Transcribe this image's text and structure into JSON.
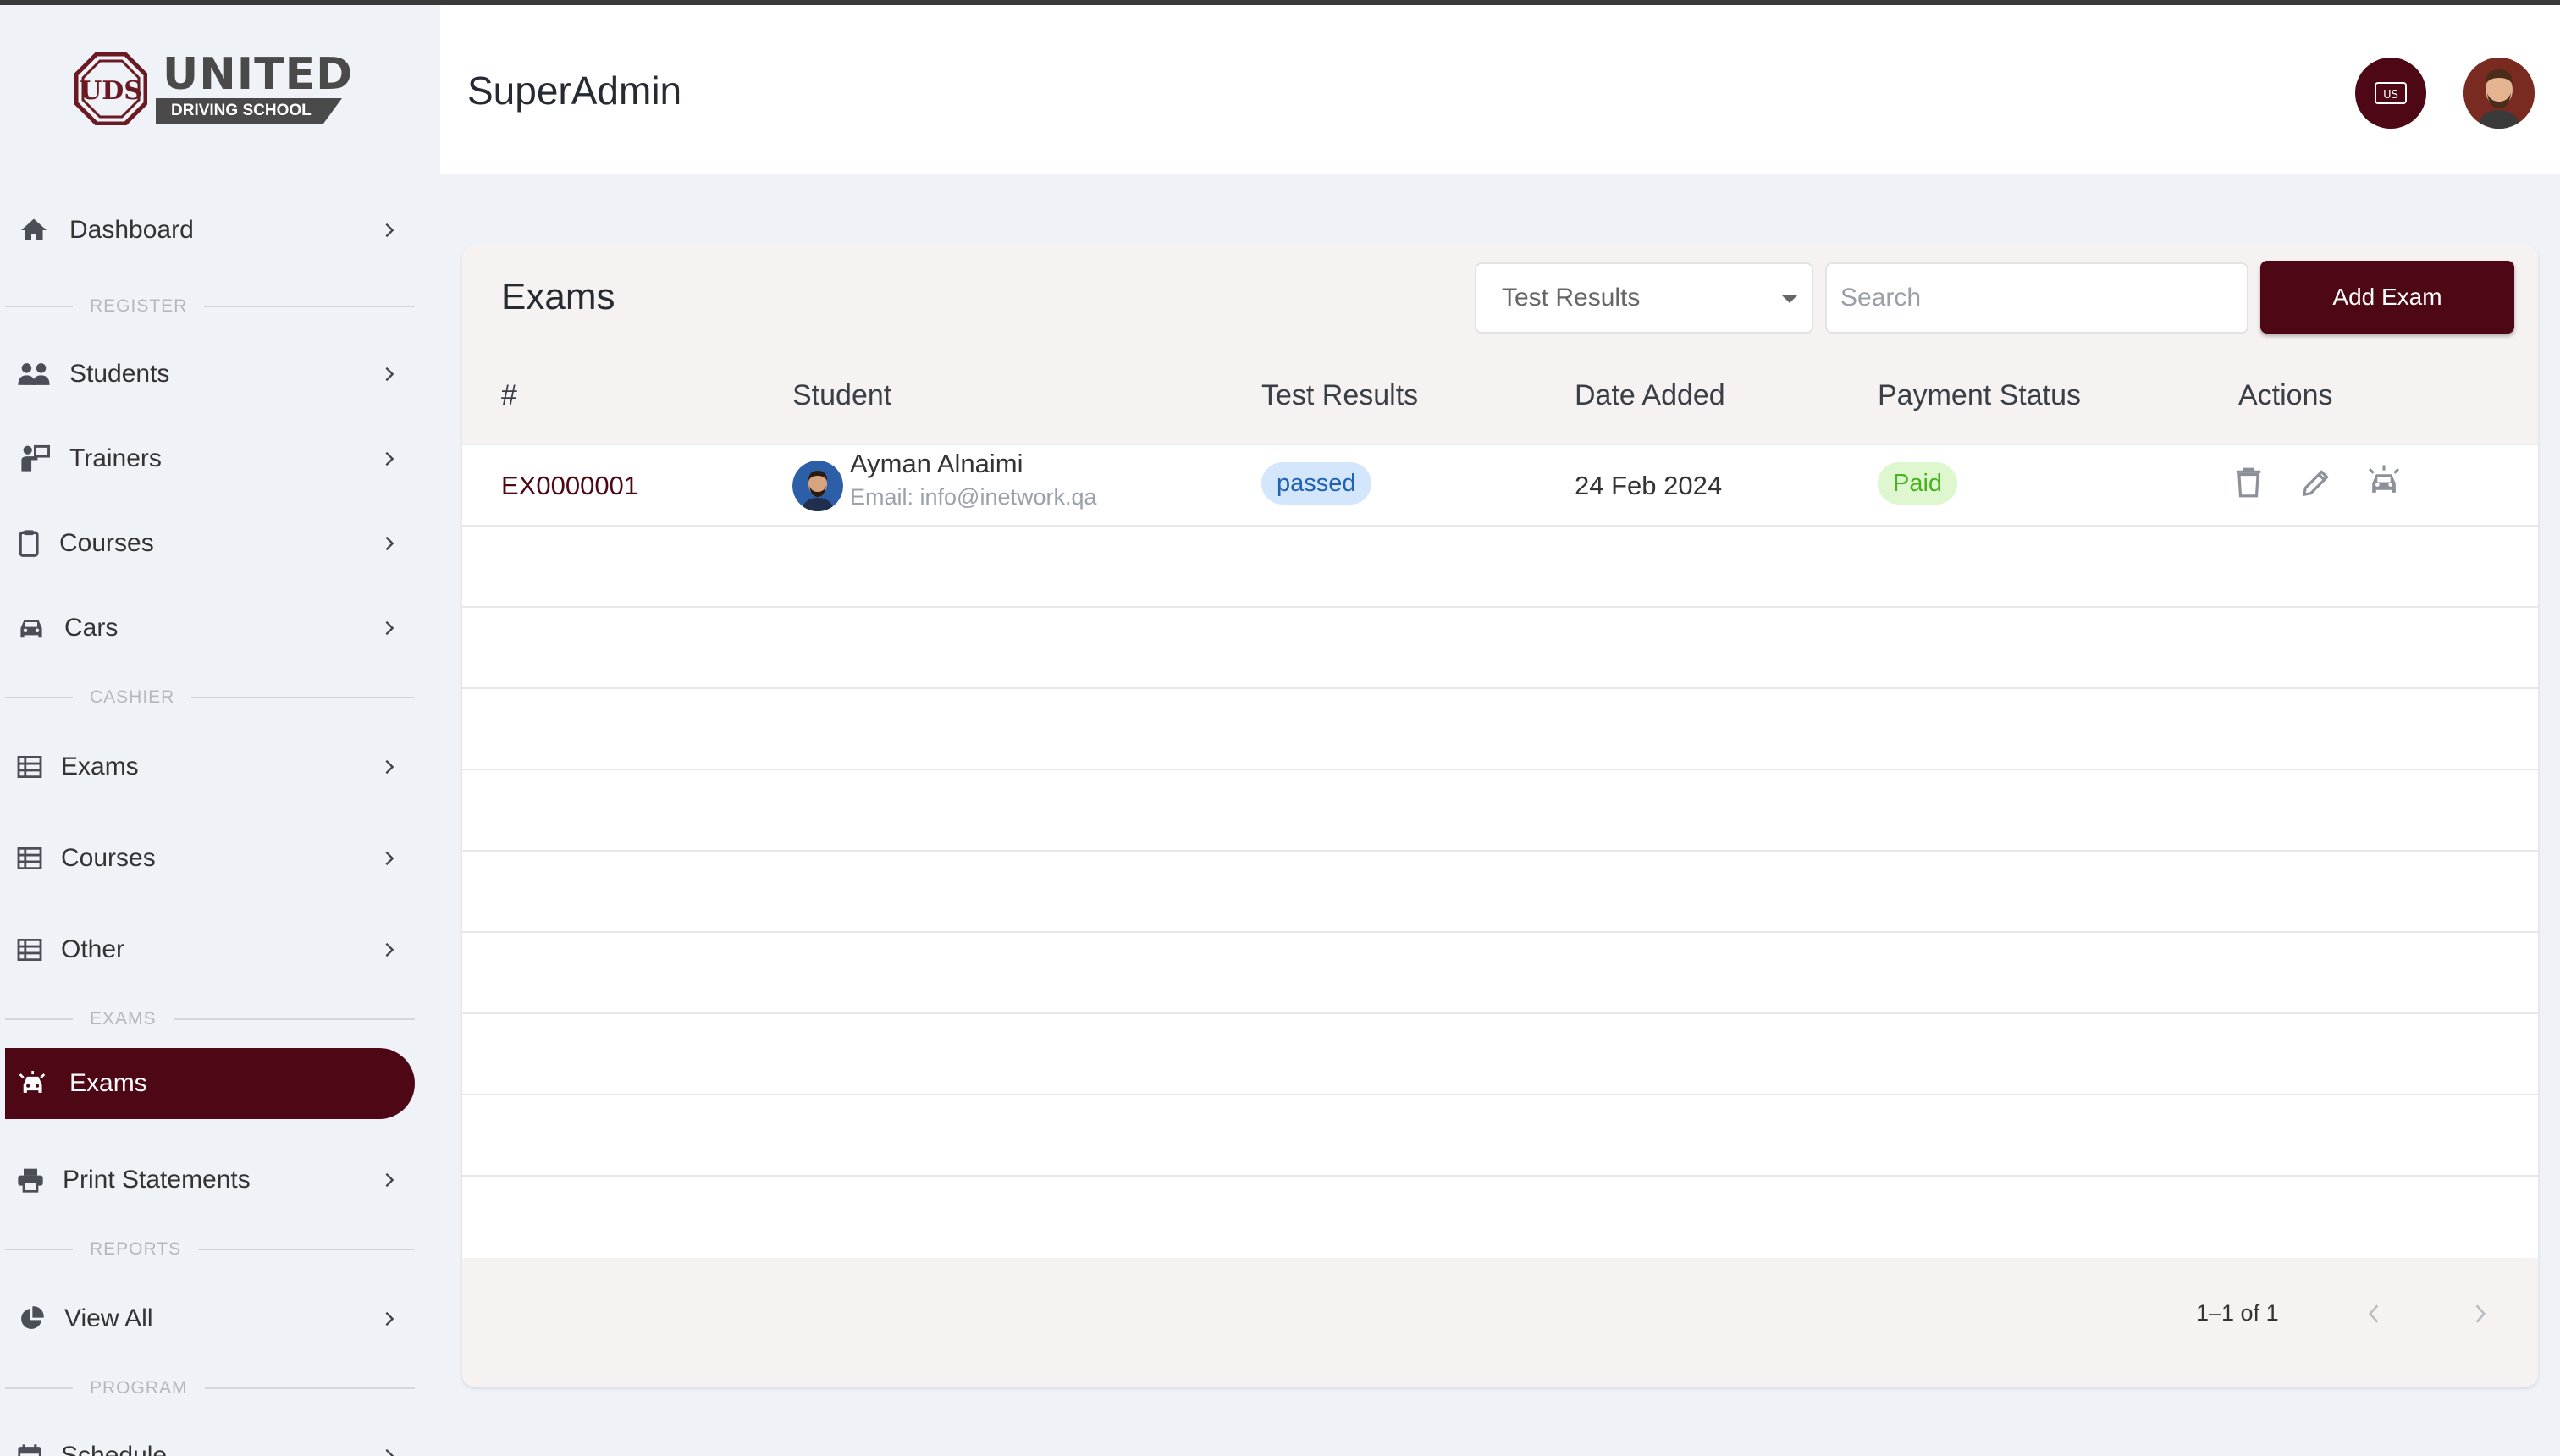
{
  "brand": {
    "name": "UNITED",
    "tagline": "DRIVING SCHOOL",
    "colors": {
      "primary": "#4e0714",
      "sidebar_bg": "#eff3f8",
      "card_header_bg": "#f6f2f1"
    }
  },
  "header": {
    "title": "SuperAdmin",
    "language_icon": "us-flag-icon",
    "avatar_icon": "user-avatar"
  },
  "sidebar": {
    "items": [
      {
        "label": "Dashboard",
        "icon": "home-icon"
      },
      {
        "section": "REGISTER"
      },
      {
        "label": "Students",
        "icon": "users-icon"
      },
      {
        "label": "Trainers",
        "icon": "trainer-icon"
      },
      {
        "label": "Courses",
        "icon": "clipboard-icon"
      },
      {
        "label": "Cars",
        "icon": "car-icon"
      },
      {
        "section": "CASHIER"
      },
      {
        "label": "Exams",
        "icon": "table-icon"
      },
      {
        "label": "Courses",
        "icon": "table-icon"
      },
      {
        "label": "Other",
        "icon": "table-icon"
      },
      {
        "section": "EXAMS"
      },
      {
        "label": "Exams",
        "icon": "car-crash-icon",
        "active": true
      },
      {
        "label": "Print Statements",
        "icon": "printer-icon"
      },
      {
        "section": "REPORTS"
      },
      {
        "label": "View All",
        "icon": "pie-chart-icon"
      },
      {
        "section": "PROGRAM"
      },
      {
        "label": "Schedule",
        "icon": "calendar-icon"
      }
    ]
  },
  "card": {
    "title": "Exams",
    "filter": {
      "selected": "Test Results"
    },
    "search": {
      "placeholder": "Search"
    },
    "add_button": "Add Exam",
    "columns": [
      "#",
      "Student",
      "Test Results",
      "Date Added",
      "Payment Status",
      "Actions"
    ],
    "rows": [
      {
        "id": "EX0000001",
        "student_name": "Ayman Alnaimi",
        "student_email": "Email: info@inetwork.qa",
        "test_result": "passed",
        "date_added": "24 Feb 2024",
        "payment_status": "Paid",
        "actions": [
          "delete-icon",
          "edit-icon",
          "car-alert-icon"
        ]
      }
    ],
    "pagination": {
      "range": "1–1 of 1"
    }
  }
}
